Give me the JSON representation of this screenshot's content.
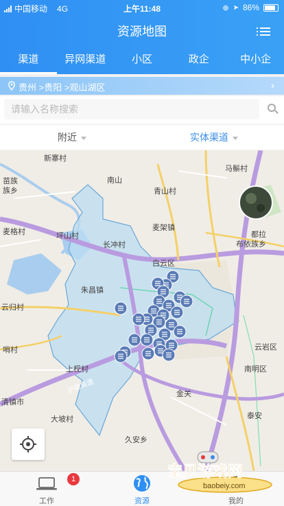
{
  "status_bar": {
    "carrier": "中国移动",
    "network": "4G",
    "time": "上午11:48",
    "battery": "86%"
  },
  "header": {
    "title": "资源地图"
  },
  "tabs": [
    {
      "label": "渠道",
      "active": true
    },
    {
      "label": "异网渠道"
    },
    {
      "label": "小区"
    },
    {
      "label": "政企"
    },
    {
      "label": "中小企"
    }
  ],
  "location": {
    "path": "贵州 >贵阳 >观山湖区"
  },
  "search": {
    "placeholder": "请输入名称搜索",
    "value": ""
  },
  "filters": {
    "left": "附近",
    "right": "实体渠道"
  },
  "map": {
    "place_labels": [
      "新寨村",
      "马鬃村",
      "南山",
      "青山村",
      "苗族",
      "族乡",
      "坪山村",
      "麦架镇",
      "麦格村",
      "长冲村",
      "都拉",
      "布依族乡",
      "白云区",
      "朱昌镇",
      "云归村",
      "哨村",
      "上枧村",
      "云岩区",
      "清镇市",
      "南明区",
      "大坡村",
      "金关",
      "泰安",
      "久安乡"
    ],
    "road_labels": [
      "沪昆高速"
    ]
  },
  "bottom_nav": [
    {
      "label": "工作",
      "badge": "1"
    },
    {
      "label": "资源",
      "active": true
    },
    {
      "label": "我的"
    }
  ],
  "watermark": {
    "title": "宝贝游戏网",
    "url": "baobeiy.com"
  },
  "colors": {
    "primary": "#2f8ff3",
    "active_filter": "#3a8ee6",
    "badge": "#e8383d",
    "marker": "#5a7bb5",
    "district_fill": "#bcdcf2"
  }
}
